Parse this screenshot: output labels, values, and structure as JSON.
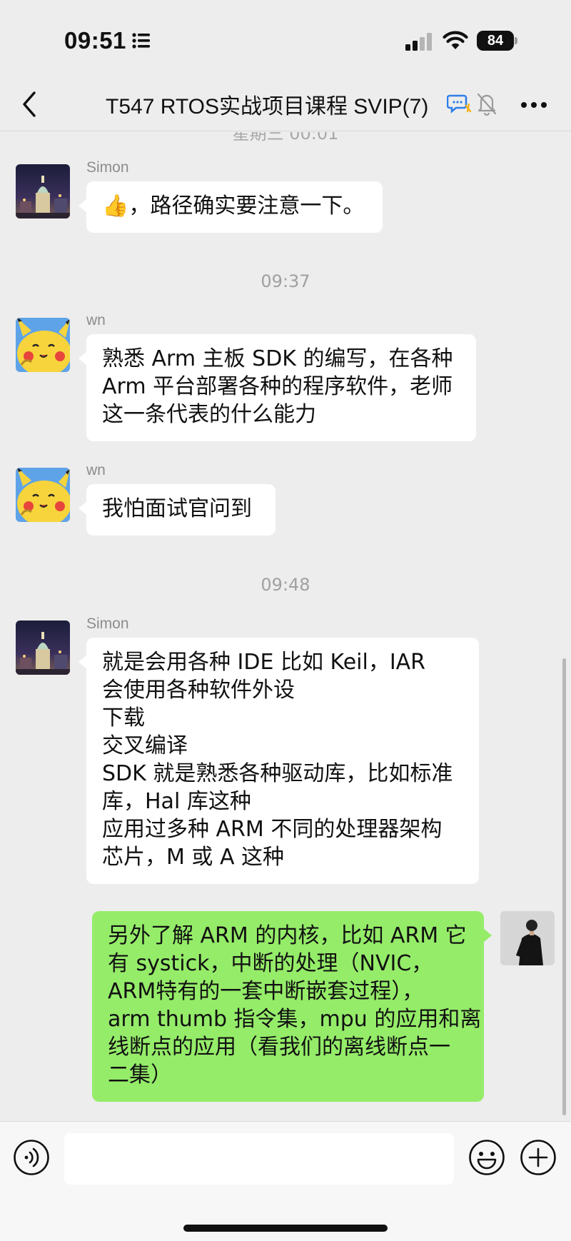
{
  "status_bar": {
    "time": "09:51",
    "battery": "84"
  },
  "nav": {
    "title": "T547 RTOS实战项目课程 SVIP(7)"
  },
  "chat": {
    "partial_timestamp": "星期三 00:01",
    "messages": [
      {
        "sender": "Simon",
        "side": "left",
        "avatar": "city-night-avatar",
        "lines": [
          "👍，路径确实要注意一下。"
        ]
      },
      {
        "timestamp": "09:37"
      },
      {
        "sender": "wn",
        "side": "left",
        "avatar": "pikachu-avatar",
        "lines": [
          "熟悉 Arm 主板 SDK 的编写，在各种",
          "Arm 平台部署各种的程序软件，老师",
          "这一条代表的什么能力"
        ]
      },
      {
        "sender": "wn",
        "side": "left",
        "avatar": "pikachu-avatar",
        "lines": [
          "我怕面试官问到"
        ]
      },
      {
        "timestamp": "09:48"
      },
      {
        "sender": "Simon",
        "side": "left",
        "avatar": "city-night-avatar",
        "lines": [
          "就是会用各种 IDE 比如 Keil，IAR",
          "会使用各种软件外设",
          "下载",
          "交叉编译",
          "SDK 就是熟悉各种驱动库，比如标准",
          "库，Hal 库这种",
          "应用过多种 ARM 不同的处理器架构",
          "芯片，M 或 A 这种"
        ]
      },
      {
        "sender": "",
        "side": "right",
        "avatar": "suit-man-avatar",
        "lines": [
          "另外了解 ARM 的内核，比如 ARM 它",
          "有 systick，中断的处理（NVIC，",
          "ARM特有的一套中断嵌套过程），",
          "arm thumb 指令集，mpu 的应用和离",
          "线断点的应用（看我们的离线断点一",
          "二集）"
        ]
      }
    ]
  },
  "input_bar": {
    "placeholder": ""
  },
  "colors": {
    "background": "#ededed",
    "bubble_in": "#ffffff",
    "bubble_out": "#95ec69",
    "timestamp": "#a0a0a0"
  },
  "icons": [
    "back-icon",
    "chat-bubbles-icon",
    "mute-icon",
    "more-icon",
    "voice-icon",
    "emoji-icon",
    "plus-icon",
    "wifi-icon",
    "signal-icon",
    "focus-icon"
  ]
}
